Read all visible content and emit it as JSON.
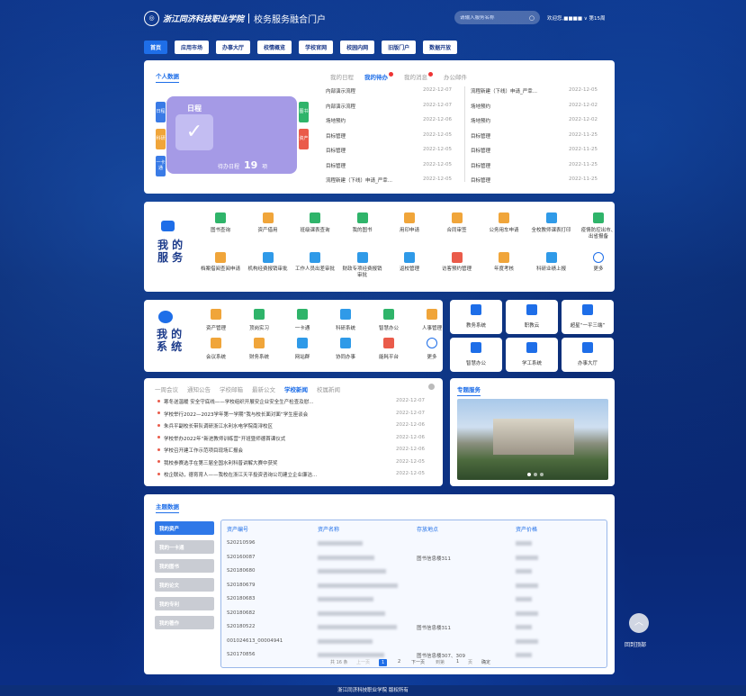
{
  "header": {
    "school": "浙江同济科技职业学院",
    "portal": "校务服务融合门户",
    "search_placeholder": "请输入服务名称",
    "welcome": "欢迎您,■■■■ ∨ 第15周"
  },
  "nav": [
    "首页",
    "应用市场",
    "办事大厅",
    "校情概览",
    "学校官网",
    "校园内网",
    "旧版门户",
    "数据开放"
  ],
  "personal": {
    "title": "个人数据",
    "tabs": [
      "我的日程",
      "我的待办",
      "我的消息",
      "办公邮件"
    ],
    "cal_title": "日程",
    "pending_label": "待办日程",
    "pending_count": "19",
    "pending_unit": "项",
    "left_tags": [
      "日程",
      "科研",
      "一卡通"
    ],
    "right_tags": [
      "图书",
      "资产"
    ],
    "todo_left": [
      [
        "内部演示流程",
        "2022-12-07"
      ],
      [
        "内部演示流程",
        "2022-12-07"
      ],
      [
        "场地预约",
        "2022-12-06"
      ],
      [
        "目标管理",
        "2022-12-05"
      ],
      [
        "目标管理",
        "2022-12-05"
      ],
      [
        "目标管理",
        "2022-12-05"
      ],
      [
        "流程新建（下线）申请_严幸...",
        "2022-12-05"
      ]
    ],
    "todo_right": [
      [
        "流程新建（下线）申请_严幸...",
        "2022-12-05"
      ],
      [
        "场地预约",
        "2022-12-02"
      ],
      [
        "场地预约",
        "2022-12-02"
      ],
      [
        "目标管理",
        "2022-11-25"
      ],
      [
        "目标管理",
        "2022-11-25"
      ],
      [
        "目标管理",
        "2022-11-25"
      ],
      [
        "目标管理",
        "2022-11-25"
      ]
    ]
  },
  "services": {
    "title1": "我 的",
    "title2": "服 务",
    "row1": [
      "图书查询",
      "资产借用",
      "班级课表查询",
      "我的图书",
      "用印申请",
      "合同审签",
      "公务用车申请",
      "全校教师课表打印",
      "疫情防控出市、出省报备"
    ],
    "row2": [
      "档案借阅查阅申请",
      "机构经费报销审批",
      "工作人员出差审批",
      "财政专项经费报销审批",
      "返校管理",
      "访客预约管理",
      "年度考核",
      "科研业绩上报",
      "更多"
    ]
  },
  "systems": {
    "title1": "我 的",
    "title2": "系 统",
    "row1": [
      "资产管理",
      "顶岗实习",
      "一卡通",
      "科研系统",
      "智慧办公",
      "人事管理"
    ],
    "row2": [
      "会议系统",
      "财务系统",
      "网站群",
      "协同办事",
      "能耗平台",
      "更多"
    ],
    "right": [
      "教务系统",
      "职教云",
      "超星“一平三端”",
      "智慧办公",
      "学工系统",
      "办事大厅"
    ]
  },
  "news": {
    "tabs": [
      "一周会议",
      "通知公告",
      "学校邮箱",
      "最新公文",
      "学校新闻",
      "校属新闻"
    ],
    "active": 4,
    "items": [
      [
        "寒冬送温暖 安全守底线——学校组织开展安企业安全生产检查及慰...",
        "2022-12-07"
      ],
      [
        "学校举行2022—2023学年第一学期“我与校长面对面”学生座谈会",
        "2022-12-07"
      ],
      [
        "朱兵平副校长带队调研浙江水利水电学院南浔校区",
        "2022-12-06"
      ],
      [
        "学校举办2022年“新进教师训练营”开班暨师德首课仪式",
        "2022-12-06"
      ],
      [
        "学校召开建工作示范项目现场汇报会",
        "2022-12-06"
      ],
      [
        "我校参赛选手在第三届全国水利科普讲解大赛中获奖",
        "2022-12-05"
      ],
      [
        "校企联动，德育育人——我校在浙江天平投资咨询公司建立企业廉洁...",
        "2022-12-05"
      ]
    ]
  },
  "special": {
    "title": "专题服务"
  },
  "theme": {
    "title": "主题数据",
    "side": [
      "我的资产",
      "我的一卡通",
      "我的图书",
      "我的论文",
      "我的专利",
      "我的著作"
    ],
    "cols": [
      "资产编号",
      "资产名称",
      "存放地点",
      "资产价格"
    ],
    "rows": [
      [
        "S20210596",
        "",
        ""
      ],
      [
        "S20160087",
        "",
        "图书信息楼311"
      ],
      [
        "S20180680",
        "",
        ""
      ],
      [
        "S20180679",
        "",
        ""
      ],
      [
        "S20180683",
        "",
        ""
      ],
      [
        "S20180682",
        "",
        ""
      ],
      [
        "S20180522",
        "",
        "图书信息楼311"
      ],
      [
        "001024613_00004941",
        "",
        ""
      ],
      [
        "S20170856",
        "",
        "图书信息楼307、309"
      ]
    ],
    "pager": [
      "共 16 条",
      "上一页",
      "1",
      "2",
      "下一页",
      "到第",
      "1",
      "页",
      "确定"
    ]
  },
  "back_top": "回到顶部",
  "footer": "浙江同济科技职业学院 版权所有",
  "colors": {
    "accent": "#1e6ee8"
  }
}
